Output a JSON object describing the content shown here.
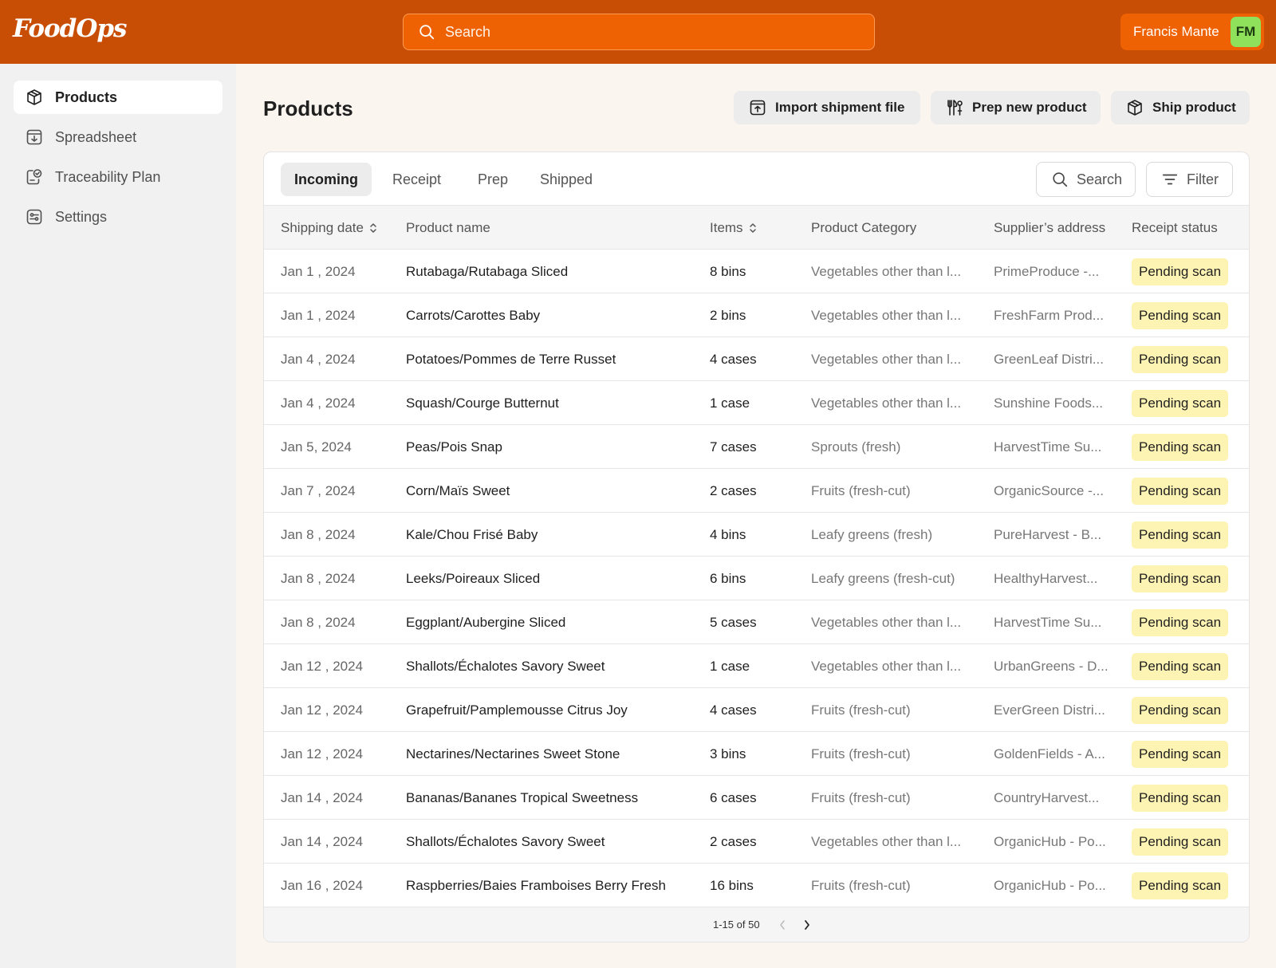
{
  "app": {
    "logo": "FoodOps",
    "search_placeholder": "Search",
    "user_name": "Francis Mante",
    "user_initials": "FM"
  },
  "colors": {
    "brand": "#c94e05",
    "brand_light": "#ef6204",
    "avatar": "#8fe05a",
    "badge": "#fdf3b3"
  },
  "sidebar": {
    "items": [
      {
        "label": "Products",
        "icon": "box-icon",
        "active": true
      },
      {
        "label": "Spreadsheet",
        "icon": "download-sheet-icon",
        "active": false
      },
      {
        "label": "Traceability Plan",
        "icon": "verified-doc-icon",
        "active": false
      },
      {
        "label": "Settings",
        "icon": "sliders-icon",
        "active": false
      }
    ]
  },
  "header": {
    "title": "Products",
    "actions": [
      {
        "label": "Import shipment file",
        "icon": "upload-file-icon"
      },
      {
        "label": "Prep new product",
        "icon": "kitchen-tools-icon"
      },
      {
        "label": "Ship product",
        "icon": "package-icon"
      }
    ]
  },
  "tabs": [
    {
      "label": "Incoming",
      "active": true
    },
    {
      "label": "Receipt",
      "active": false
    },
    {
      "label": "Prep",
      "active": false
    },
    {
      "label": "Shipped",
      "active": false
    }
  ],
  "toolbar": {
    "search_label": "Search",
    "filter_label": "Filter"
  },
  "table": {
    "columns": [
      "Shipping date",
      "Product name",
      "Items",
      "Product Category",
      "Supplier’s address",
      "Receipt status"
    ],
    "rows": [
      {
        "date": "Jan 1 , 2024",
        "name": "Rutabaga/Rutabaga Sliced",
        "items": "8 bins",
        "category": "Vegetables other than l...",
        "supplier": "PrimeProduce -...",
        "status": "Pending scan"
      },
      {
        "date": "Jan 1 , 2024",
        "name": "Carrots/Carottes Baby",
        "items": "2 bins",
        "category": "Vegetables other than l...",
        "supplier": "FreshFarm Prod...",
        "status": "Pending scan"
      },
      {
        "date": "Jan 4 , 2024",
        "name": "Potatoes/Pommes de Terre Russet",
        "items": "4 cases",
        "category": "Vegetables other than l...",
        "supplier": "GreenLeaf Distri...",
        "status": "Pending scan"
      },
      {
        "date": "Jan 4 , 2024",
        "name": "Squash/Courge Butternut",
        "items": "1 case",
        "category": "Vegetables other than l...",
        "supplier": "Sunshine Foods...",
        "status": "Pending scan"
      },
      {
        "date": "Jan  5, 2024",
        "name": "Peas/Pois Snap",
        "items": "7 cases",
        "category": "Sprouts (fresh)",
        "supplier": "HarvestTime Su...",
        "status": "Pending scan"
      },
      {
        "date": "Jan 7 , 2024",
        "name": "Corn/Maïs Sweet",
        "items": "2 cases",
        "category": "Fruits (fresh-cut)",
        "supplier": "OrganicSource -...",
        "status": "Pending scan"
      },
      {
        "date": "Jan 8 , 2024",
        "name": "Kale/Chou Frisé Baby",
        "items": "4 bins",
        "category": "Leafy greens (fresh)",
        "supplier": "PureHarvest - B...",
        "status": "Pending scan"
      },
      {
        "date": "Jan 8 , 2024",
        "name": "Leeks/Poireaux Sliced",
        "items": "6 bins",
        "category": "Leafy greens (fresh-cut)",
        "supplier": "HealthyHarvest...",
        "status": "Pending scan"
      },
      {
        "date": "Jan 8 , 2024",
        "name": "Eggplant/Aubergine Sliced",
        "items": "5 cases",
        "category": "Vegetables other than l...",
        "supplier": "HarvestTime Su...",
        "status": "Pending scan"
      },
      {
        "date": "Jan 12 , 2024",
        "name": "Shallots/Échalotes Savory Sweet",
        "items": "1 case",
        "category": "Vegetables other than l...",
        "supplier": "UrbanGreens - D...",
        "status": "Pending scan"
      },
      {
        "date": "Jan 12 , 2024",
        "name": "Grapefruit/Pamplemousse Citrus Joy",
        "items": "4 cases",
        "category": "Fruits (fresh-cut)",
        "supplier": "EverGreen Distri...",
        "status": "Pending scan"
      },
      {
        "date": "Jan 12 , 2024",
        "name": "Nectarines/Nectarines Sweet Stone",
        "items": "3 bins",
        "category": "Fruits (fresh-cut)",
        "supplier": "GoldenFields - A...",
        "status": "Pending scan"
      },
      {
        "date": "Jan 14 , 2024",
        "name": "Bananas/Bananes Tropical Sweetness",
        "items": "6 cases",
        "category": "Fruits (fresh-cut)",
        "supplier": "CountryHarvest...",
        "status": "Pending scan"
      },
      {
        "date": "Jan 14 , 2024",
        "name": "Shallots/Échalotes Savory Sweet",
        "items": "2 cases",
        "category": "Vegetables other than l...",
        "supplier": "OrganicHub - Po...",
        "status": "Pending scan"
      },
      {
        "date": "Jan 16 , 2024",
        "name": "Raspberries/Baies Framboises Berry Fresh",
        "items": "16 bins",
        "category": "Fruits (fresh-cut)",
        "supplier": "OrganicHub - Po...",
        "status": "Pending scan"
      }
    ]
  },
  "pagination": {
    "info": "1-15 of 50"
  }
}
